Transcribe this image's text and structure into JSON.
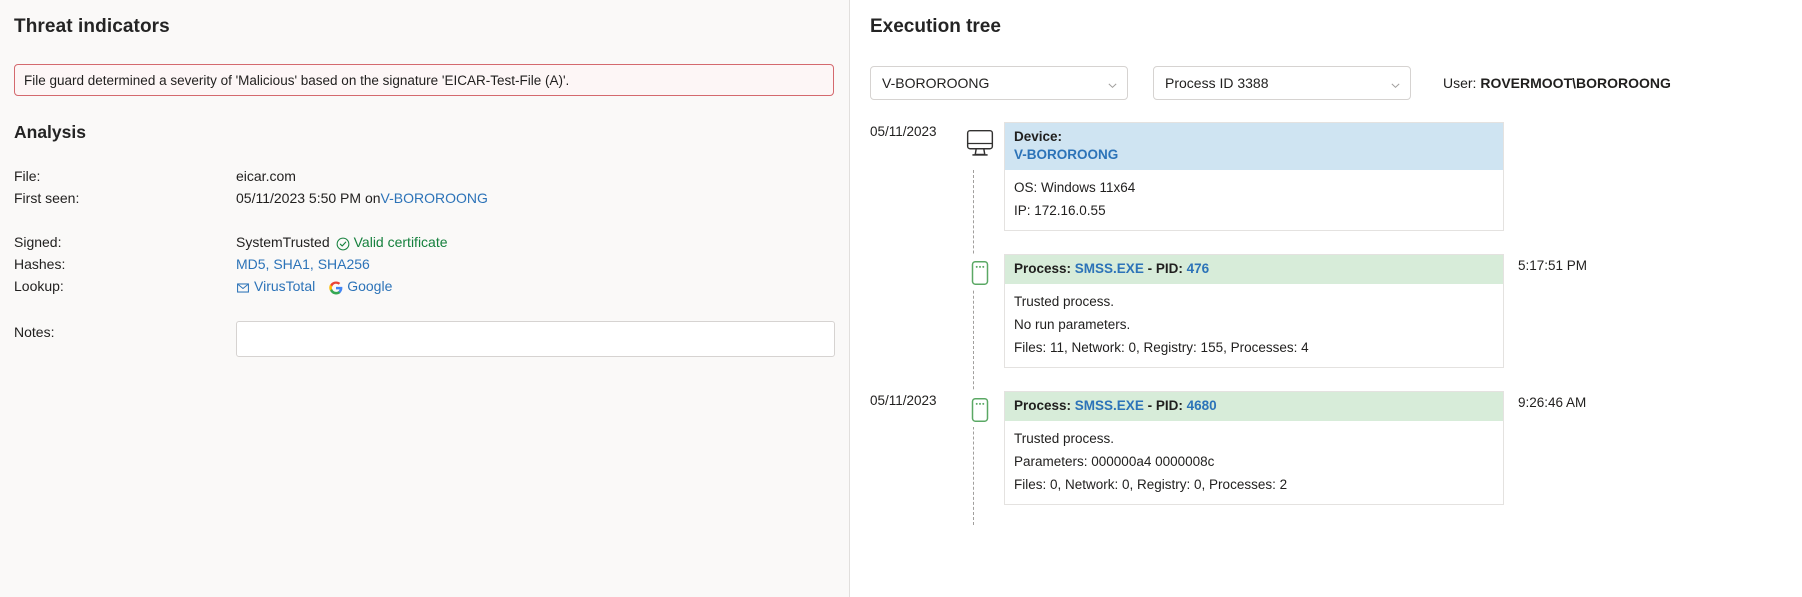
{
  "left": {
    "title": "Threat indicators",
    "threat_message": "File guard determined a severity of 'Malicious' based on the signature 'EICAR-Test-File (A)'.",
    "analysis_title": "Analysis",
    "rows": {
      "file_label": "File:",
      "file_value": "eicar.com",
      "first_seen_label": "First seen:",
      "first_seen_value": "05/11/2023 5:50 PM on ",
      "first_seen_device": "V-BOROROONG",
      "signed_label": "Signed:",
      "signed_value": "SystemTrusted",
      "valid_certificate": "Valid certificate",
      "hashes_label": "Hashes:",
      "hashes_value": "MD5, SHA1, SHA256",
      "lookup_label": "Lookup:",
      "lookup_virustotal": "VirusTotal",
      "lookup_google": "Google",
      "notes_label": "Notes:",
      "notes_value": "",
      "notes_placeholder": ""
    },
    "icons": {
      "valid_cert": "check-circle-icon",
      "virustotal": "virustotal-icon",
      "google": "google-icon"
    }
  },
  "right": {
    "title": "Execution tree",
    "device_select": "V-BOROROONG",
    "process_select": "Process ID 3388",
    "user_prefix": "User: ",
    "user_value": "ROVERMOOT\\BOROROONG",
    "nodes": [
      {
        "date": "05/11/2023",
        "time": "",
        "kind": "device",
        "icon": "monitor-icon",
        "header_label": "Device:",
        "header_value": "V-BOROROONG",
        "body": [
          "OS: Windows 11x64",
          "IP: 172.16.0.55"
        ]
      },
      {
        "date": "",
        "time": "5:17:51 PM",
        "kind": "process",
        "icon": "process-icon",
        "header_prefix": "Process: ",
        "header_name": "SMSS.EXE",
        "header_sep": " - PID: ",
        "header_pid": "476",
        "body": [
          "Trusted process.",
          "No run parameters.",
          "Files: 11, Network: 0, Registry: 155, Processes: 4"
        ]
      },
      {
        "date": "05/11/2023",
        "time": "9:26:46 AM",
        "kind": "process",
        "icon": "process-icon",
        "header_prefix": "Process: ",
        "header_name": "SMSS.EXE",
        "header_sep": " - PID: ",
        "header_pid": "4680",
        "body": [
          "Trusted process.",
          "Parameters: 000000a4 0000008c",
          "Files: 0, Network: 0, Registry: 0, Processes: 2"
        ]
      }
    ]
  },
  "colors": {
    "link": "#2c73b8",
    "threat_border": "#d4696e",
    "device_header": "#cfe4f2",
    "process_header": "#d7ecd9",
    "valid_green": "#15803d"
  }
}
